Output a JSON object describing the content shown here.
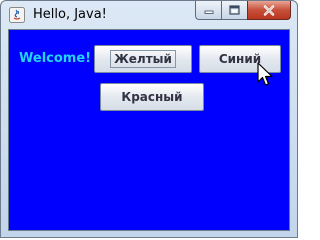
{
  "window": {
    "title": "Hello, Java!",
    "controls": {
      "minimize_icon": "minimize-icon",
      "maximize_icon": "maximize-icon",
      "close_icon": "close-icon"
    }
  },
  "panel": {
    "background_color": "#0000ff",
    "welcome_label": "Welcome!",
    "welcome_color": "#22d3f5",
    "buttons": [
      {
        "label": "Желтый",
        "focused": true
      },
      {
        "label": "Синий",
        "hovered": true
      },
      {
        "label": "Красный"
      }
    ]
  }
}
